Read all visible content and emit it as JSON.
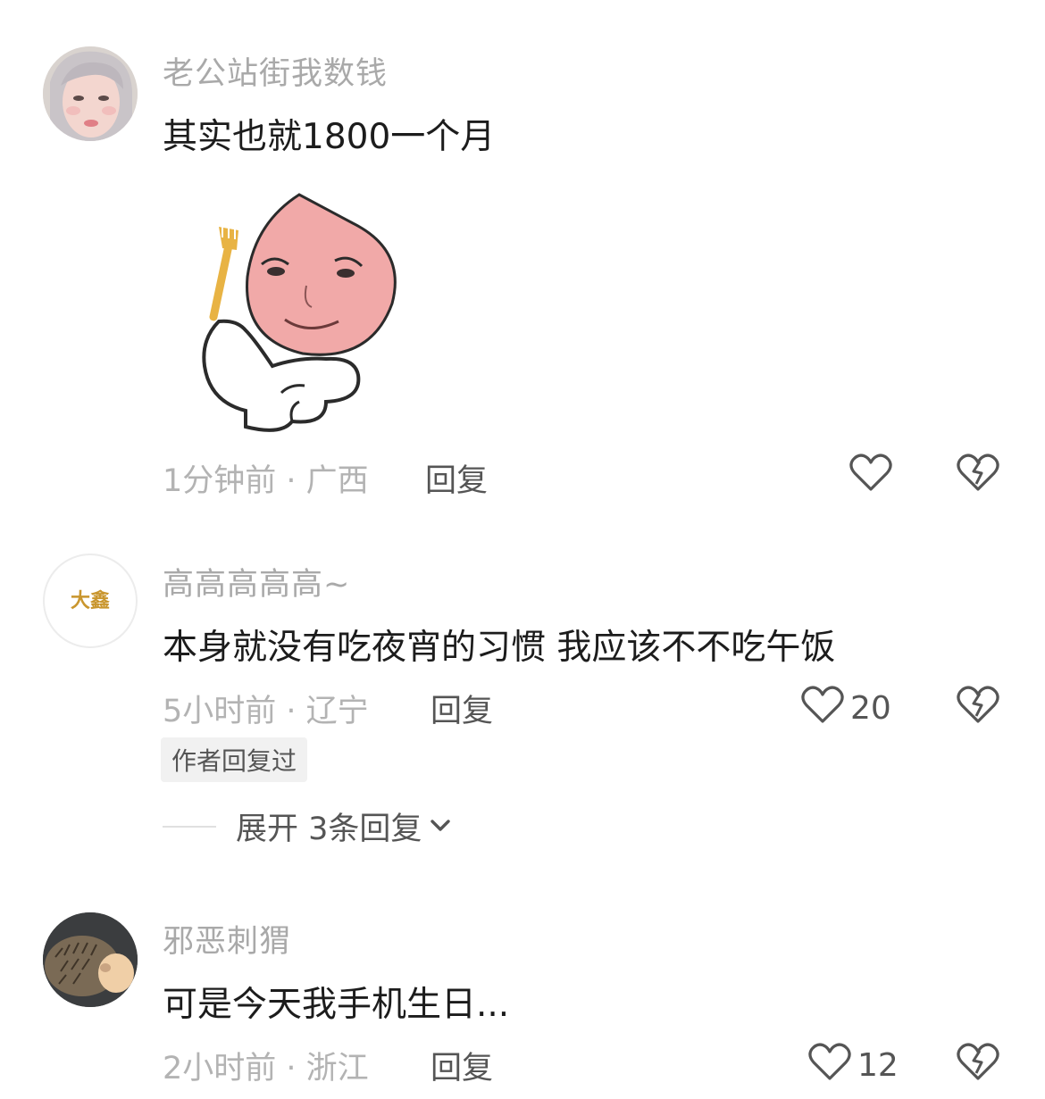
{
  "comments": [
    {
      "username": "老公站街我数钱",
      "text": "其实也就1800一个月",
      "time_location": "1分钟前 · 广西",
      "reply_label": "回复",
      "likes": ""
    },
    {
      "username": "高高高高高~",
      "text": "本身就没有吃夜宵的习惯 我应该不不吃午饭",
      "time_location": "5小时前 · 辽宁",
      "reply_label": "回复",
      "likes": "20",
      "badge": "作者回复过",
      "expand_label": "展开 3条回复",
      "avatar_text": "大鑫"
    },
    {
      "username": "邪恶刺猬",
      "text": "可是今天我手机生日...",
      "time_location": "2小时前 · 浙江",
      "reply_label": "回复",
      "likes": "12"
    }
  ],
  "icons": {
    "like": "heart-outline-icon",
    "dislike": "broken-heart-icon",
    "expand": "chevron-down-icon"
  },
  "colors": {
    "username": "#a9a9a9",
    "meta": "#b3b3b3",
    "text": "#1c1c1c",
    "badge_bg": "#f1f1f1"
  }
}
